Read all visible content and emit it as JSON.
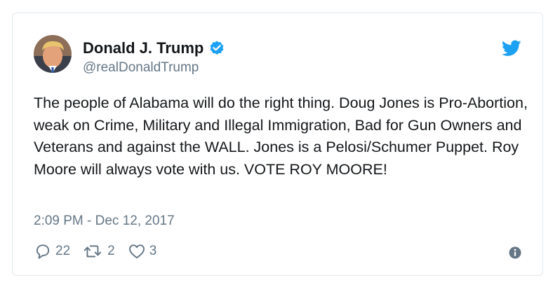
{
  "tweet": {
    "author": {
      "display_name": "Donald J. Trump",
      "handle": "@realDonaldTrump",
      "verified": true,
      "avatar_icon": "profile-photo"
    },
    "text": "The people of Alabama will do the right thing. Doug Jones is Pro-Abortion, weak on Crime, Military and Illegal Immigration, Bad for Gun Owners and Veterans and against the WALL. Jones is a Pelosi/Schumer Puppet. Roy Moore will always vote with us. VOTE ROY MOORE!",
    "timestamp": "2:09 PM - Dec 12, 2017",
    "stats": {
      "replies": "22",
      "retweets": "2",
      "likes": "3"
    }
  },
  "icons": {
    "brand": "twitter-bird-icon",
    "verified": "verified-badge-icon",
    "reply": "reply-icon",
    "retweet": "retweet-icon",
    "like": "heart-icon",
    "info": "info-icon"
  },
  "colors": {
    "brand_blue": "#1da1f2",
    "text_primary": "#14171a",
    "text_secondary": "#657786",
    "border": "#e1e8ed"
  }
}
